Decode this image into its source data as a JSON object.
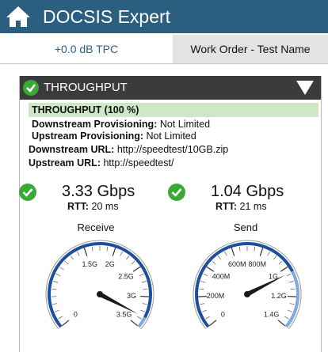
{
  "header": {
    "title": "DOCSIS Expert"
  },
  "tabs": {
    "tpc": "+0.0 dB TPC",
    "work_order": "Work Order - Test Name"
  },
  "section": {
    "title": "THROUGHPUT"
  },
  "status": {
    "text": "THROUGHPUT (100 %)"
  },
  "info": {
    "downstream_prov_label": "Downstream Provisioning:",
    "downstream_prov_value": " Not Limited",
    "upstream_prov_label": "Upstream Provisioning:",
    "upstream_prov_value": " Not Limited",
    "downstream_url_label": "Downstream URL:",
    "downstream_url_value": " http://speedtest/10GB.zip",
    "upstream_url_label": "Upstream URL:",
    "upstream_url_value": " http://speedtest/"
  },
  "receive": {
    "value_text": "3.33 Gbps",
    "rtt_label": "RTT:",
    "rtt_value": " 20 ms",
    "label": "Receive",
    "gauge": {
      "min": 0,
      "max": 3.5,
      "value": 3.33,
      "ticks": [
        {
          "v": 0,
          "t": "0"
        },
        {
          "v": 1.5,
          "t": "1.5G"
        },
        {
          "v": 2,
          "t": "2G"
        },
        {
          "v": 2.5,
          "t": "2.5G"
        },
        {
          "v": 3,
          "t": "3G"
        },
        {
          "v": 3.5,
          "t": "3.5G"
        }
      ]
    }
  },
  "send": {
    "value_text": "1.04 Gbps",
    "rtt_label": "RTT:",
    "rtt_value": " 21 ms",
    "label": "Send",
    "gauge": {
      "min": 0,
      "max": 1.4,
      "value": 1.04,
      "ticks": [
        {
          "v": 0,
          "t": "0"
        },
        {
          "v": 0.2,
          "t": "200M"
        },
        {
          "v": 0.4,
          "t": "400M"
        },
        {
          "v": 0.6,
          "t": "600M"
        },
        {
          "v": 0.8,
          "t": "800M"
        },
        {
          "v": 1.0,
          "t": "1G"
        },
        {
          "v": 1.2,
          "t": "1.2G"
        },
        {
          "v": 1.4,
          "t": "1.4G"
        }
      ]
    }
  },
  "colors": {
    "header": "#2a5f80",
    "check": "#3aa936",
    "arc": "#1d4f9c",
    "arc_light": "#7fa7e0"
  }
}
